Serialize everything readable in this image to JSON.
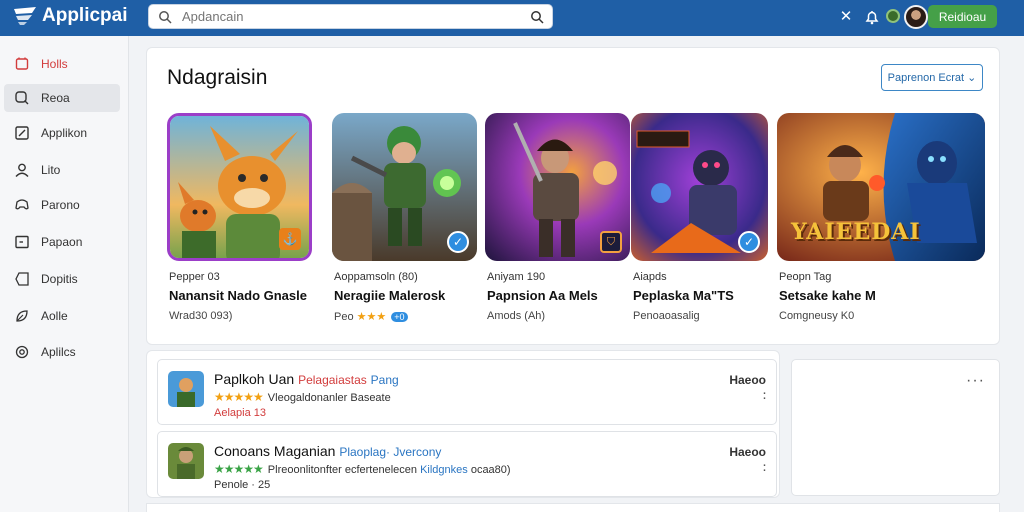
{
  "app": {
    "title": "Applicpai"
  },
  "search": {
    "placeholder": "Apdancain",
    "value": ""
  },
  "topbar": {
    "icon_1": "x-icon",
    "icon_2": "bell-icon",
    "primary_button": "Reidioau"
  },
  "sidebar": {
    "items": [
      {
        "label": "Holls",
        "icon": "home-icon"
      },
      {
        "label": "Reoa",
        "icon": "search-icon"
      },
      {
        "label": "Applikon",
        "icon": "edit-icon"
      },
      {
        "label": "Lito",
        "icon": "user-icon"
      },
      {
        "label": "Parono",
        "icon": "gamepad-icon"
      },
      {
        "label": "Papaon",
        "icon": "box-icon"
      },
      {
        "label": "Dopitis",
        "icon": "tag-icon"
      },
      {
        "label": "Aolle",
        "icon": "leaf-icon"
      },
      {
        "label": "Aplilcs",
        "icon": "settings-icon"
      }
    ]
  },
  "featured": {
    "title": "Ndagraisin",
    "action_button": "Paprenon Ecrat",
    "cards": [
      {
        "subtitle": "Pepper 03",
        "name": "Nanansit Nado Gnasle",
        "meta": "Wrad30 093)"
      },
      {
        "subtitle": "Aoppamsoln (80)",
        "name": "Neragiie Malerosk",
        "meta_label": "Peo",
        "stars": "★★★",
        "badge": "+0"
      },
      {
        "subtitle": "Aniyam 190",
        "name": "Papnsion Aa Mels",
        "meta": "Amods (Ah)"
      },
      {
        "subtitle": "Aiapds",
        "name": "Peplaska Ma\"TS",
        "meta": "Penoaoasalig"
      },
      {
        "subtitle": "Peopn Tag",
        "name": "Setsake kahe M",
        "meta": "Comgneusy K0",
        "overlay_text": "YAIEEDAI"
      }
    ]
  },
  "list": {
    "rows": [
      {
        "title": "Paplkoh Uan",
        "tag_red": "Pelagaiastas",
        "tag_blue": "Pang",
        "stars": "★★★★★",
        "desc": "Vleogaldonanler Baseate",
        "desc_highlight": "",
        "desc_tail": "",
        "meta": "Aelapia 13",
        "right": "Haeoo"
      },
      {
        "title": "Conoans Maganian",
        "tag_red": "",
        "tag_blue": "Plaoplag· Jvercony",
        "stars": "★★★★★",
        "desc": "Plreoonlitonfter ecfertenelecen ",
        "desc_highlight": "Kildgnkes",
        "desc_tail": " ocaa80)",
        "meta": "Penole · 25",
        "right": "Haeoo"
      }
    ]
  },
  "colors": {
    "topbar": "#1f5fa6",
    "accent_green": "#45a048",
    "accent_blue": "#2f8ee0",
    "star": "#f2a012",
    "red": "#d23c3c"
  }
}
